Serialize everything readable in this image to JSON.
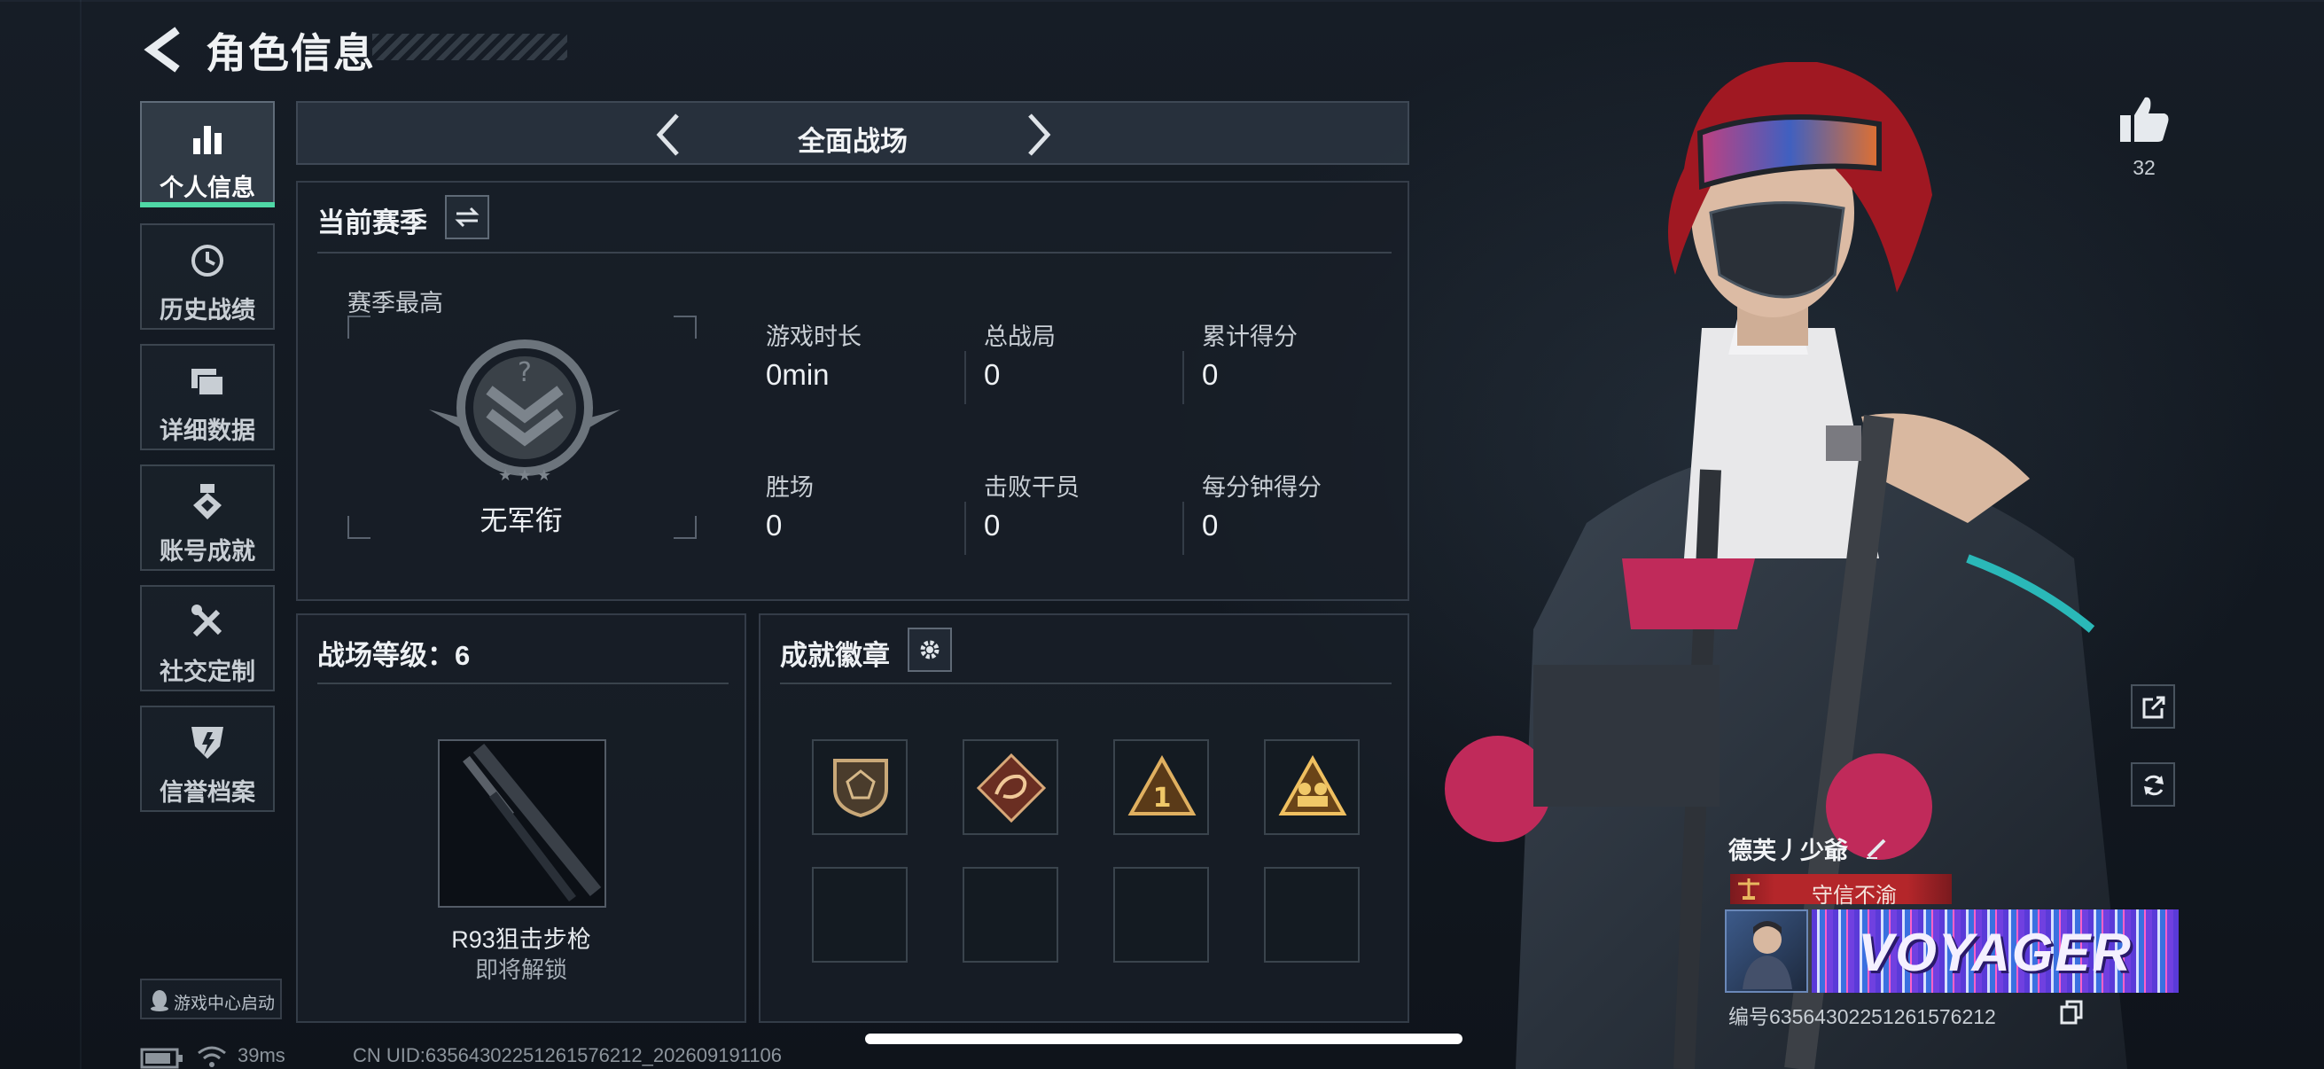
{
  "header": {
    "title": "角色信息"
  },
  "sidebar": {
    "items": [
      {
        "label": "个人信息",
        "icon": "bar-chart-icon",
        "active": true
      },
      {
        "label": "历史战绩",
        "icon": "history-icon"
      },
      {
        "label": "详细数据",
        "icon": "folder-icon"
      },
      {
        "label": "账号成就",
        "icon": "medal-icon"
      },
      {
        "label": "社交定制",
        "icon": "tools-icon"
      },
      {
        "label": "信誉档案",
        "icon": "shield-icon"
      }
    ],
    "game_center_label": "游戏中心启动"
  },
  "mode": {
    "label": "全面战场"
  },
  "season": {
    "title": "当前赛季",
    "best_label": "赛季最高",
    "rank_name": "无军衔",
    "stats": [
      {
        "label": "游戏时长",
        "value": "0min"
      },
      {
        "label": "总战局",
        "value": "0"
      },
      {
        "label": "累计得分",
        "value": "0"
      },
      {
        "label": "胜场",
        "value": "0"
      },
      {
        "label": "击败干员",
        "value": "0"
      },
      {
        "label": "每分钟得分",
        "value": "0"
      }
    ]
  },
  "battle_level": {
    "title": "战场等级：6",
    "weapon_name": "R93狙击步枪",
    "weapon_status": "即将解锁"
  },
  "badges": {
    "title": "成就徽章",
    "filled": 4,
    "total": 8
  },
  "likes": {
    "count": "32"
  },
  "profile": {
    "name": "德芙丿少爺",
    "tag": "守信不渝",
    "banner_text": "VOYAGER",
    "id_line": "编号6356430225126157​6212"
  },
  "status": {
    "ping": "39ms",
    "uid": "CN UID:6356430225126157​6212_202609191106"
  },
  "colors": {
    "accent": "#4fd8a6",
    "tag_red": "#b4262a",
    "banner": "#8a5cff"
  }
}
